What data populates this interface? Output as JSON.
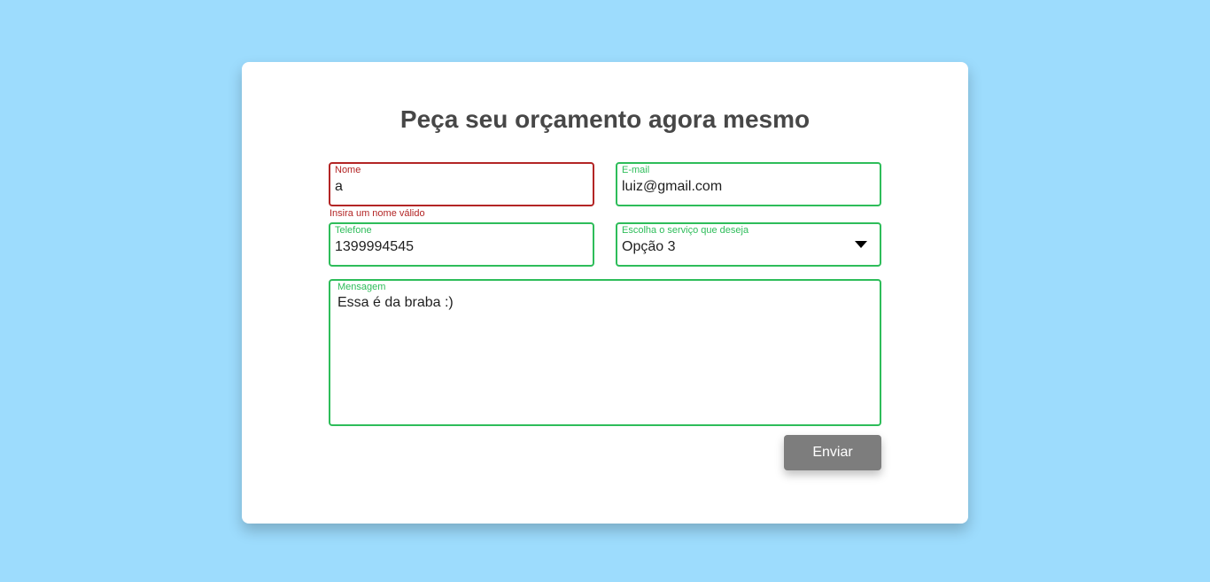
{
  "form": {
    "title": "Peça seu orçamento agora mesmo",
    "nome": {
      "label": "Nome",
      "value": "a",
      "error": "Insira um nome válido"
    },
    "email": {
      "label": "E-mail",
      "value": "luiz@gmail.com"
    },
    "telefone": {
      "label": "Telefone",
      "value": "1399994545"
    },
    "servico": {
      "label": "Escolha o serviço que deseja",
      "value": "Opção 3"
    },
    "mensagem": {
      "label": "Mensagem",
      "value": "Essa é da braba :)"
    },
    "submit_label": "Enviar"
  },
  "colors": {
    "background": "#9ddcfd",
    "valid": "#2ebd5a",
    "invalid": "#b32525",
    "button": "#7d7d7d"
  },
  "icons": {
    "select_caret": "caret-down-icon"
  }
}
